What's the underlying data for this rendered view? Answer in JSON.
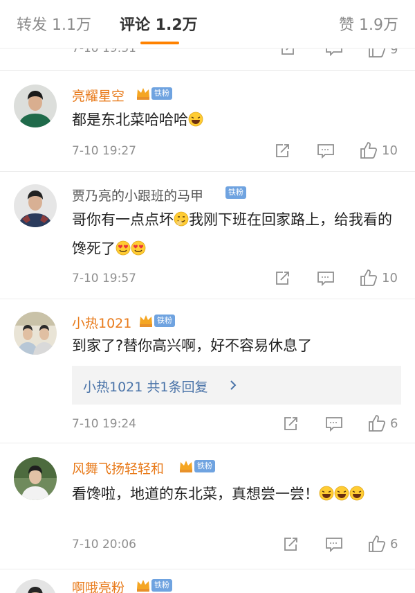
{
  "tabs": {
    "repost": "转发 1.1万",
    "comment": "评论 1.2万",
    "like": "赞 1.9万"
  },
  "cutoff": {
    "time": "7-10 19:51",
    "likes": "9"
  },
  "badge_label": "铁粉",
  "comments": [
    {
      "user": "亮耀星空",
      "text": "都是东北菜哈哈哈",
      "time": "7-10 19:27",
      "likes": "10"
    },
    {
      "user": "贾乃亮的小跟班的马甲",
      "text_a": "哥你有一点点坏",
      "text_b": "我刚下班在回家路上，给我看的馋死了",
      "time": "7-10 19:57",
      "likes": "10"
    },
    {
      "user": "小热1021",
      "text": "到家了?替你高兴啊，好不容易休息了",
      "reply": "小热1021  共1条回复",
      "time": "7-10 19:24",
      "likes": "6"
    },
    {
      "user": "风舞飞扬轻轻和",
      "text": "看馋啦，地道的东北菜，真想尝一尝！",
      "time": "7-10 20:06",
      "likes": "6"
    },
    {
      "user": "啊哦亮粉"
    }
  ],
  "colors": {
    "accent": "#ff8200",
    "vip_name": "#e87a1a",
    "fan_badge": "#6fa3e0",
    "reply_link": "#4a73a8"
  },
  "icons": [
    "crown-icon",
    "share-icon",
    "comment-icon",
    "thumbs-up-icon",
    "laugh-emoji-icon",
    "heart-eyes-emoji-icon",
    "grin-emoji-icon",
    "chevron-right-icon"
  ]
}
